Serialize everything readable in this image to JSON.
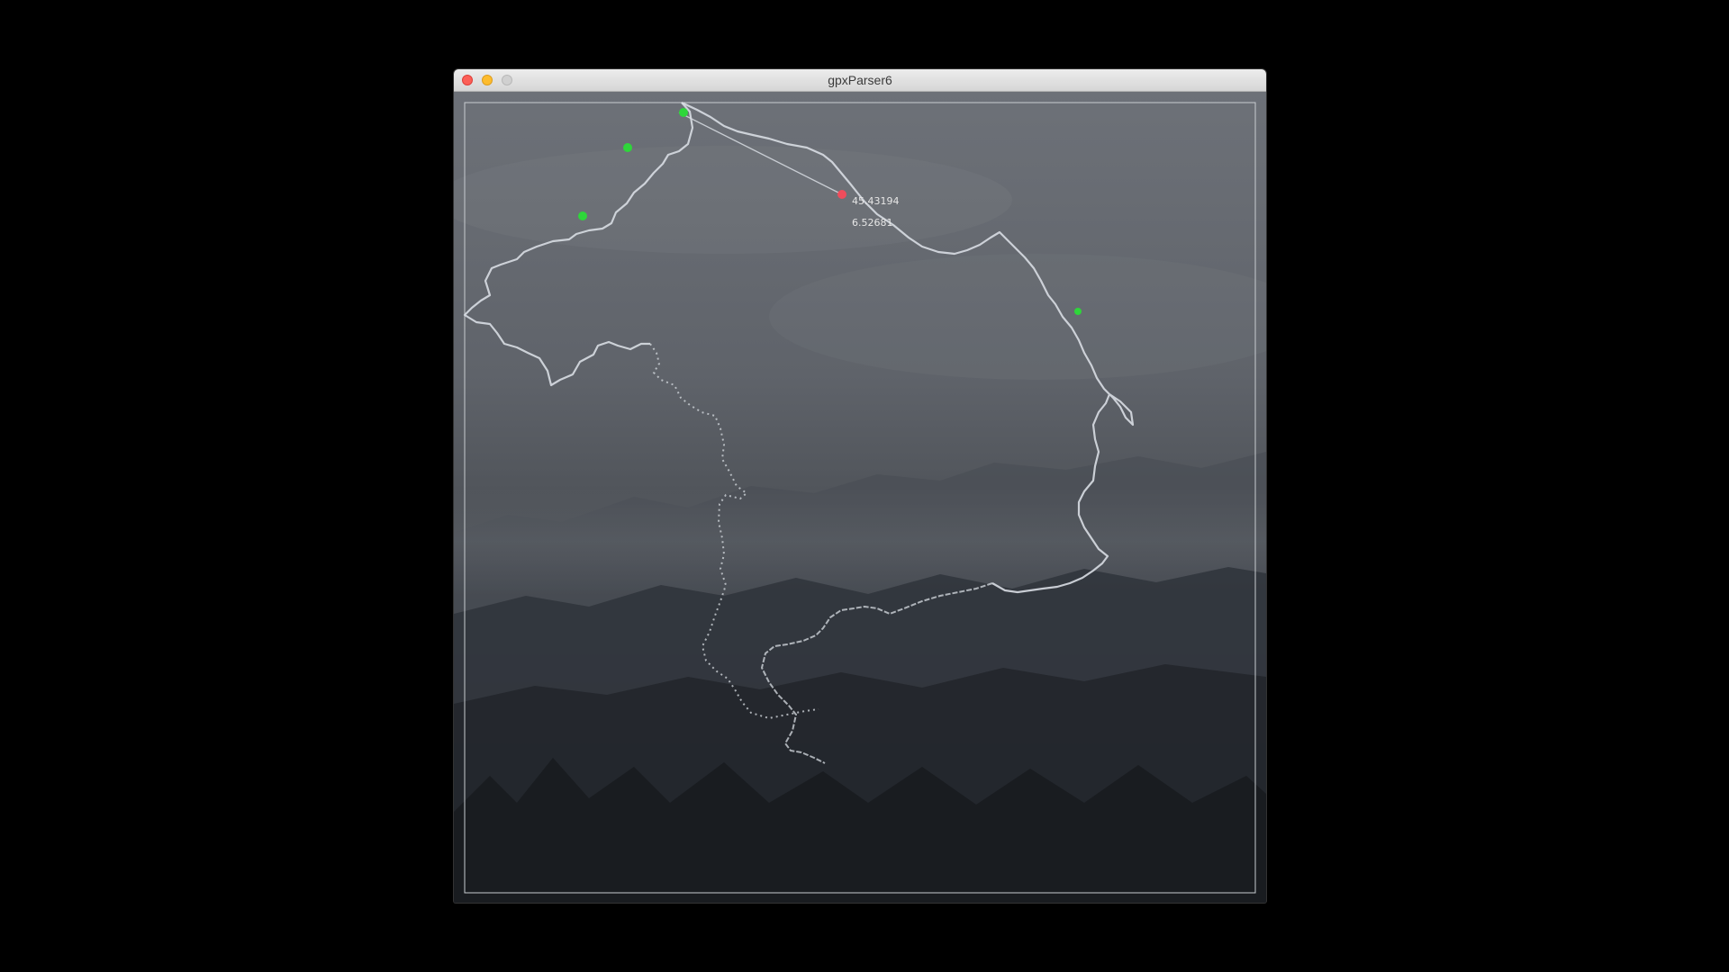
{
  "window": {
    "title": "gpxParser6"
  },
  "map": {
    "selected_point": {
      "lat": "45.43194",
      "lon": "6.52681"
    },
    "colors": {
      "track": "#d8dde3",
      "waypoint": "#2ed63a",
      "selected": "#ef4d5c",
      "frame": "#c8ccd0"
    },
    "background": "misty mountain forest photo, darkened"
  }
}
